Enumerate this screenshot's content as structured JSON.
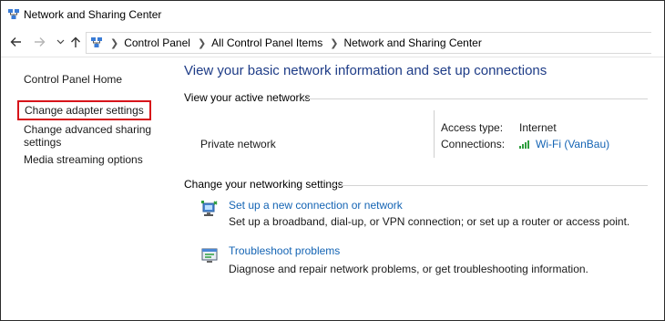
{
  "window": {
    "title": "Network and Sharing Center"
  },
  "nav": {
    "back_icon": "arrow-left-icon",
    "forward_icon": "arrow-right-icon",
    "recent_icon": "chevron-down-icon",
    "up_icon": "arrow-up-icon",
    "breadcrumbs": [
      "Control Panel",
      "All Control Panel Items",
      "Network and Sharing Center"
    ]
  },
  "sidebar": {
    "home": "Control Panel Home",
    "adapter": "Change adapter settings",
    "advanced": "Change advanced sharing settings",
    "media": "Media streaming options"
  },
  "main": {
    "heading": "View your basic network information and set up connections",
    "active_label": "View your active networks",
    "network_name": "Private network",
    "access_type_label": "Access type:",
    "access_type_value": "Internet",
    "connections_label": "Connections:",
    "connection_value": "Wi-Fi (VanBau)",
    "change_label": "Change your networking settings",
    "tasks": [
      {
        "title": "Set up a new connection or network",
        "desc": "Set up a broadband, dial-up, or VPN connection; or set up a router or access point."
      },
      {
        "title": "Troubleshoot problems",
        "desc": "Diagnose and repair network problems, or get troubleshooting information."
      }
    ]
  },
  "colors": {
    "heading": "#1e3c87",
    "link": "#1464b4",
    "highlight_border": "#d7141a"
  }
}
